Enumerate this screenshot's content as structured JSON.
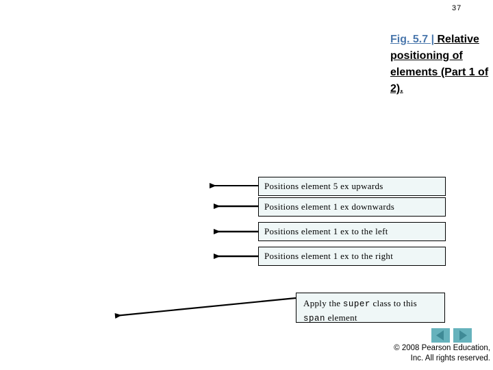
{
  "slide": {
    "page_number": "37",
    "background_color": "#ffffff"
  },
  "caption": {
    "fig_label": "Fig. 5.7 |",
    "fig_text": " Relative positioning of elements (Part 1 of 2).",
    "label_color": "#4a77ac",
    "text_color": "#000000"
  },
  "callouts": [
    {
      "id": "callout-position-up",
      "text": "Positions element 5 ex upwards"
    },
    {
      "id": "callout-position-down",
      "text": "Positions element 1 ex downwards"
    },
    {
      "id": "callout-position-left",
      "text": "Positions element 1 ex to the left"
    },
    {
      "id": "callout-position-right",
      "text": "Positions element 1 ex to the right"
    }
  ],
  "callout_super": {
    "line1_a": "Apply the ",
    "line1_code": "super",
    "line1_b": " class to this",
    "line2_code": "span",
    "line2_b": " element"
  },
  "navigation": {
    "prev_label": "previous-slide",
    "next_label": "next-slide",
    "button_color": "#66b2bc",
    "glyph_color": "#3f8a96"
  },
  "footer": {
    "line1": "© 2008 Pearson Education,",
    "line2": "Inc.  All rights reserved."
  },
  "style": {
    "callout_fill": "#eff7f7",
    "callout_border": "#000000",
    "arrow_color": "#000000"
  }
}
